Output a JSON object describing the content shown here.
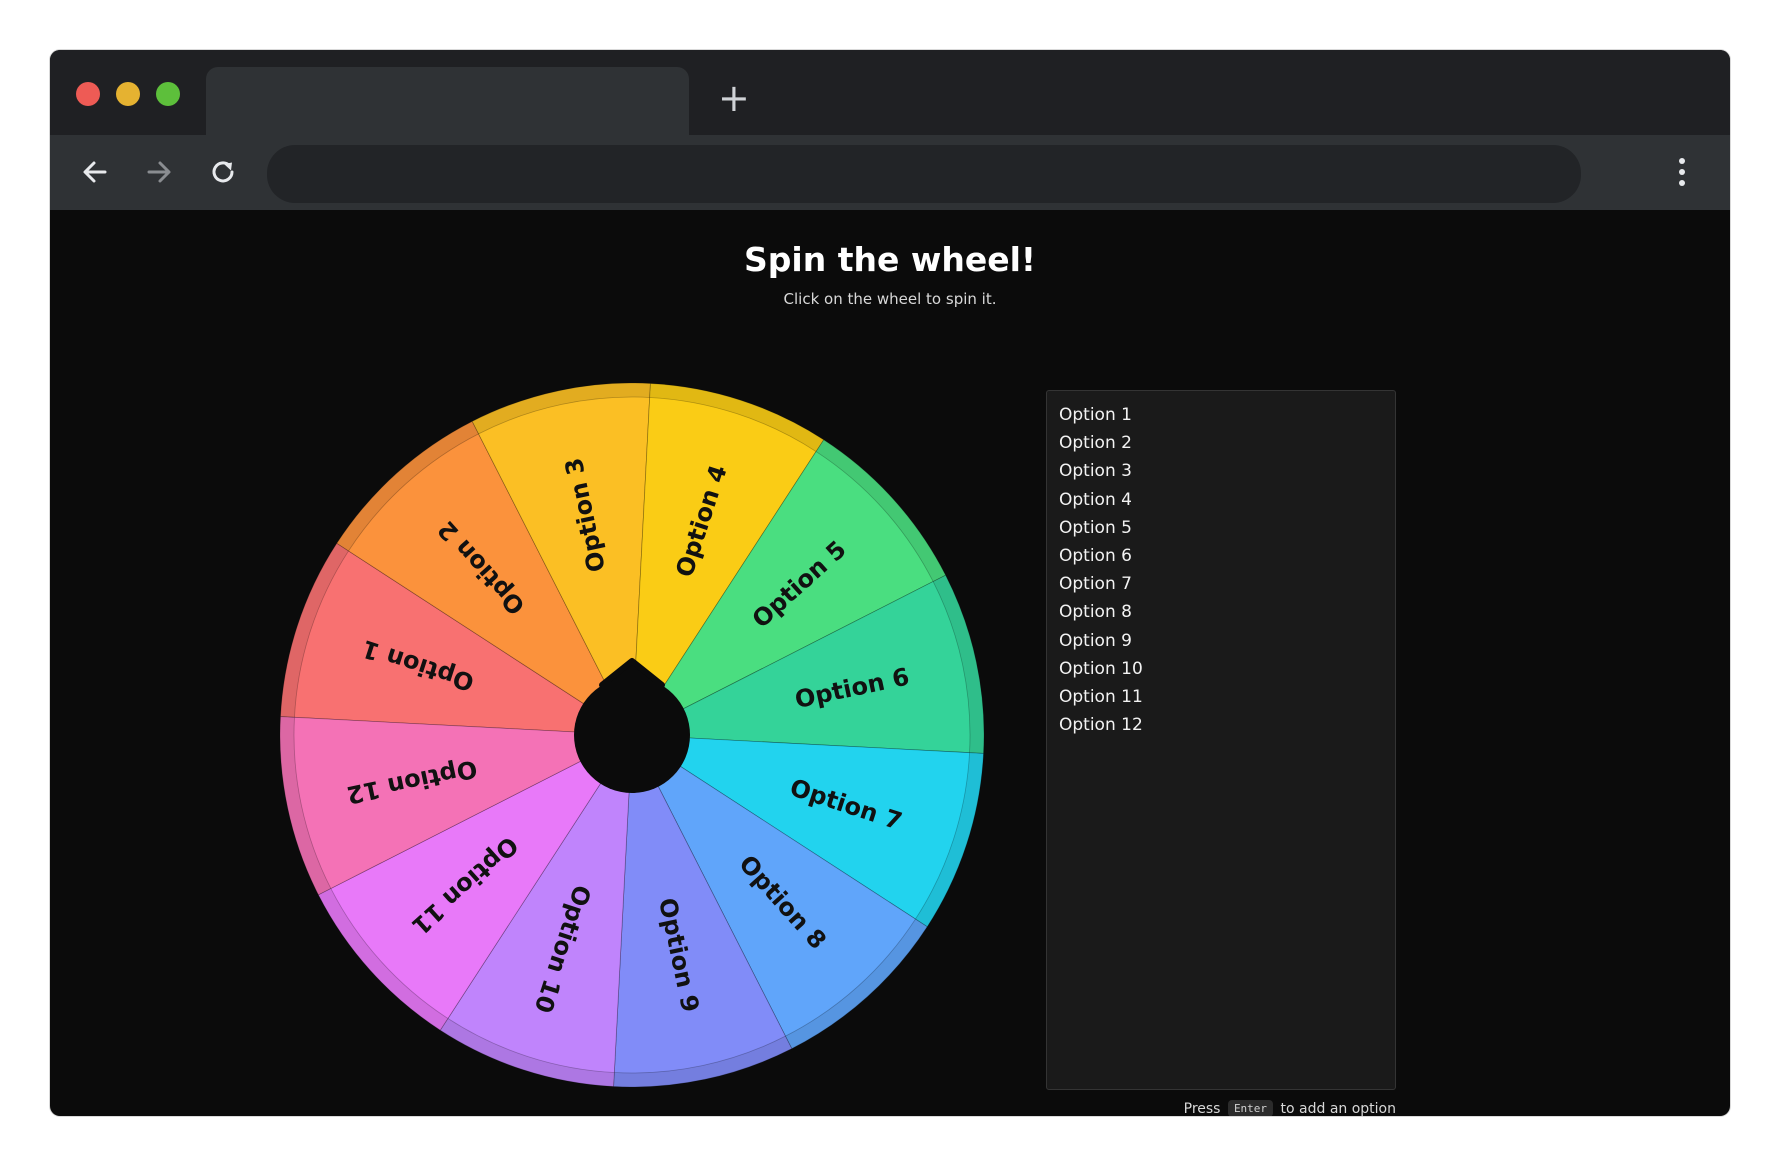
{
  "browser": {
    "new_tab_label": "+",
    "address_value": "",
    "icons": [
      "back-arrow-icon",
      "forward-arrow-icon",
      "reload-icon",
      "more-vert-icon",
      "new-tab-plus-icon"
    ]
  },
  "page": {
    "title": "Spin the wheel!",
    "subtitle": "Click on the wheel to spin it."
  },
  "wheel": {
    "segments": [
      {
        "label": "Option 1",
        "color": "#f87171"
      },
      {
        "label": "Option 2",
        "color": "#fb923c"
      },
      {
        "label": "Option 3",
        "color": "#fbbf24"
      },
      {
        "label": "Option 4",
        "color": "#facc15"
      },
      {
        "label": "Option 5",
        "color": "#4ade80"
      },
      {
        "label": "Option 6",
        "color": "#34d399"
      },
      {
        "label": "Option 7",
        "color": "#22d3ee"
      },
      {
        "label": "Option 8",
        "color": "#60a5fa"
      },
      {
        "label": "Option 9",
        "color": "#818cf8"
      },
      {
        "label": "Option 10",
        "color": "#c084fc"
      },
      {
        "label": "Option 11",
        "color": "#e879f9"
      },
      {
        "label": "Option 12",
        "color": "#f472b6"
      }
    ],
    "hub_color": "#0b0b0b"
  },
  "options_list": {
    "items": [
      "Option 1",
      "Option 2",
      "Option 3",
      "Option 4",
      "Option 5",
      "Option 6",
      "Option 7",
      "Option 8",
      "Option 9",
      "Option 10",
      "Option 11",
      "Option 12"
    ]
  },
  "hint": {
    "prefix": "Press",
    "key": "Enter",
    "suffix": "to add an option"
  }
}
